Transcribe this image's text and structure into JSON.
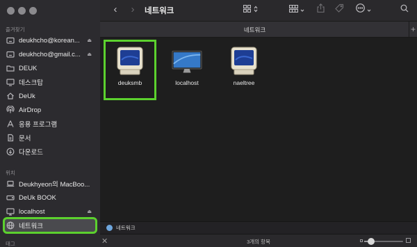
{
  "window": {
    "title": "네트워크",
    "tab_title": "네트워크"
  },
  "sidebar": {
    "favorites_label": "즐겨찾기",
    "favorites": [
      {
        "label": "deukhcho@korean...",
        "icon": "cloud-drive-icon",
        "eject": true
      },
      {
        "label": "deukhcho@gmail.c...",
        "icon": "cloud-drive-icon",
        "eject": true
      },
      {
        "label": "DEUK",
        "icon": "folder-icon",
        "eject": false
      },
      {
        "label": "데스크탑",
        "icon": "desktop-icon",
        "eject": false
      },
      {
        "label": "DeUk",
        "icon": "home-icon",
        "eject": false
      },
      {
        "label": "AirDrop",
        "icon": "airdrop-icon",
        "eject": false
      },
      {
        "label": "응용 프로그램",
        "icon": "applications-icon",
        "eject": false
      },
      {
        "label": "문서",
        "icon": "document-icon",
        "eject": false
      },
      {
        "label": "다운로드",
        "icon": "downloads-icon",
        "eject": false
      }
    ],
    "locations_label": "위치",
    "locations": [
      {
        "label": "Deukhyeon의 MacBoo...",
        "icon": "laptop-icon",
        "eject": false
      },
      {
        "label": "DeUk BOOK",
        "icon": "drive-icon",
        "eject": false
      },
      {
        "label": "localhost",
        "icon": "display-icon",
        "eject": true
      },
      {
        "label": "네트워크",
        "icon": "network-globe-icon",
        "eject": false,
        "selected": true
      }
    ],
    "tags_label": "태그",
    "eject_glyph": "⏏"
  },
  "toolbar": {
    "back_glyph": "‹",
    "forward_glyph": "›",
    "more_glyph": "⋯"
  },
  "files": [
    {
      "name": "deuksmb",
      "icon": "crt-monitor-icon",
      "selected": true
    },
    {
      "name": "localhost",
      "icon": "imac-icon",
      "selected": false
    },
    {
      "name": "naeltree",
      "icon": "crt-monitor-icon",
      "selected": false
    }
  ],
  "pathbar": {
    "label": "네트워크"
  },
  "status": {
    "text": "3개의 항목",
    "icon_size_level": 0.1
  },
  "colors": {
    "highlight": "#5cd12e",
    "accent": "#6ea6dd"
  }
}
